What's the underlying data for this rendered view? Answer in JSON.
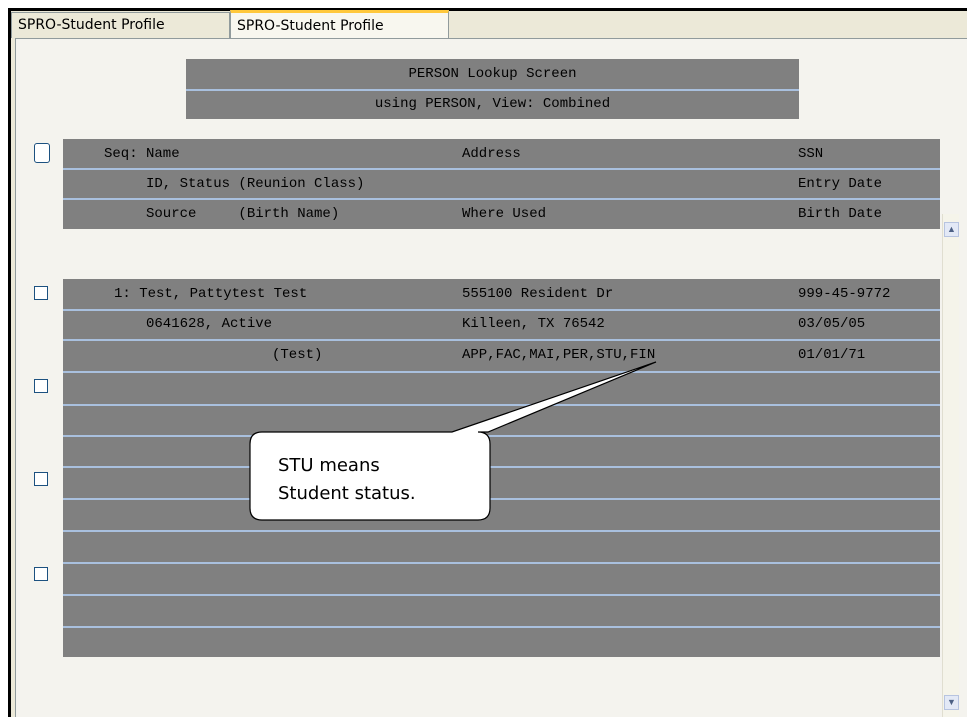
{
  "tabs": [
    "SPRO-Student Profile",
    "SPRO-Student Profile"
  ],
  "header": {
    "title": "PERSON Lookup Screen",
    "subtitle": "using PERSON, View: Combined"
  },
  "columns": {
    "row1": {
      "seq_name": "Seq: Name",
      "address": "Address",
      "ssn": "SSN"
    },
    "row2": {
      "id_status": "ID, Status (Reunion Class)",
      "entry_date": "Entry Date"
    },
    "row3": {
      "source": "Source     (Birth Name)",
      "where_used": "Where Used",
      "birth_date": "Birth Date"
    }
  },
  "record": {
    "seq_name": "1: Test, Pattytest Test",
    "address1": "555100 Resident Dr",
    "ssn": "999-45-9772",
    "id_status": "0641628, Active",
    "address2": "Killeen, TX 76542",
    "entry_date": "03/05/05",
    "birth_name": "(Test)",
    "where_used": "APP,FAC,MAI,PER,STU,FIN",
    "birth_date": "01/01/71"
  },
  "callout": {
    "line1": "STU means",
    "line2": "Student status."
  },
  "colors": {
    "grid_grey": "#808080",
    "separator": "#a9c0de",
    "tab_highlight": "#ffc83c"
  },
  "scrollbar": {
    "up": "up-arrow-icon",
    "down": "down-arrow-icon"
  }
}
